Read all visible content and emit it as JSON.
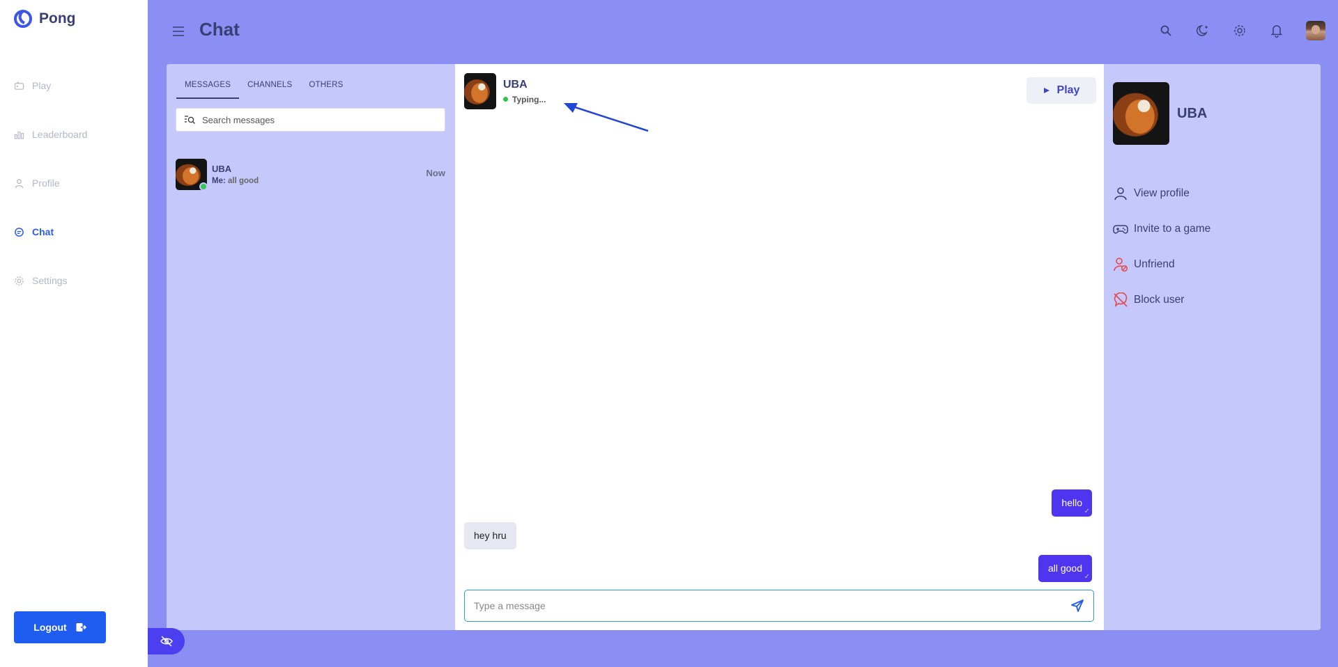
{
  "app": {
    "name": "Pong"
  },
  "sidebar": {
    "items": [
      {
        "label": "Play",
        "icon": "controller-icon"
      },
      {
        "label": "Leaderboard",
        "icon": "bar-chart-icon"
      },
      {
        "label": "Profile",
        "icon": "user-icon"
      },
      {
        "label": "Chat",
        "icon": "chat-icon",
        "active": true
      },
      {
        "label": "Settings",
        "icon": "gear-icon"
      }
    ],
    "logout_label": "Logout"
  },
  "header": {
    "title": "Chat",
    "actions": [
      "search-icon",
      "dark-mode-icon",
      "gear-icon",
      "bell-icon",
      "avatar"
    ]
  },
  "conversations": {
    "tabs": [
      "MESSAGES",
      "CHANNELS",
      "OTHERS"
    ],
    "active_tab": "MESSAGES",
    "search_placeholder": "Search messages",
    "items": [
      {
        "name": "UBA",
        "last_prefix": "Me:",
        "last_message": "all good",
        "time": "Now",
        "online": true
      }
    ]
  },
  "chat": {
    "contact_name": "UBA",
    "status": "Typing...",
    "play_label": "Play",
    "messages": [
      {
        "direction": "out",
        "text": "hello"
      },
      {
        "direction": "in",
        "text": "hey hru"
      },
      {
        "direction": "out",
        "text": "all good"
      }
    ],
    "composer_placeholder": "Type a message"
  },
  "info": {
    "name": "UBA",
    "actions": [
      {
        "label": "View profile",
        "icon": "user-icon"
      },
      {
        "label": "Invite to a game",
        "icon": "gamepad-icon"
      },
      {
        "label": "Unfriend",
        "icon": "user-remove-icon"
      },
      {
        "label": "Block user",
        "icon": "block-chat-icon"
      }
    ]
  },
  "colors": {
    "background": "#8b8ff4",
    "primary": "#1f5cf0",
    "message_out": "#4f34f0",
    "danger": "#e5484d",
    "online": "#34c65a"
  }
}
